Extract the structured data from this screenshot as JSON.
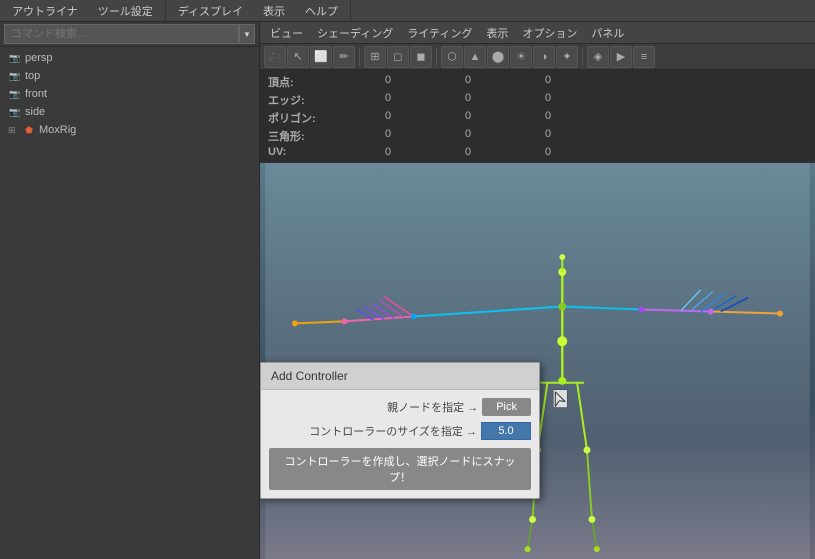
{
  "menuBar": {
    "sections": [
      {
        "name": "outliner",
        "items": [
          "アウトライナ",
          "ツール設定"
        ]
      },
      {
        "name": "display",
        "items": [
          "ディスプレイ",
          "表示",
          "ヘルプ"
        ]
      }
    ]
  },
  "leftPanel": {
    "tabs": [
      "アウトライナ"
    ],
    "toolbar": [
      "ディスプレイ",
      "表示",
      "ヘルプ"
    ],
    "searchPlaceholder": "コマンド検索...",
    "treeItems": [
      {
        "id": "persp",
        "label": "persp",
        "indent": 4,
        "icon": "camera"
      },
      {
        "id": "top",
        "label": "top",
        "indent": 4,
        "icon": "camera"
      },
      {
        "id": "front",
        "label": "front",
        "indent": 4,
        "icon": "camera"
      },
      {
        "id": "side",
        "label": "side",
        "indent": 4,
        "icon": "camera"
      },
      {
        "id": "moxrig",
        "label": "MoxRig",
        "indent": 0,
        "icon": "group",
        "expand": true
      }
    ]
  },
  "viewport": {
    "menus": [
      "ビュー",
      "シェーディング",
      "ライティング",
      "表示",
      "オプション",
      "パネル"
    ],
    "stats": {
      "labels": [
        "頂点:",
        "エッジ:",
        "ポリゴン:",
        "三角形:",
        "UV:"
      ],
      "cols": [
        "0",
        "0",
        "0",
        "0",
        "0",
        "0",
        "0",
        "0",
        "0",
        "0",
        "0",
        "0"
      ]
    }
  },
  "dialog": {
    "title": "Add Controller",
    "rows": [
      {
        "label": "親ノードを指定 →",
        "type": "button",
        "buttonLabel": "Pick"
      },
      {
        "label": "コントローラーのサイズを指定 →",
        "type": "input",
        "inputValue": "5.0"
      }
    ],
    "createButton": "コントローラーを作成し、選択ノードにスナップ！"
  },
  "stats": {
    "vertex": {
      "label": "頂点:",
      "values": [
        "0",
        "0",
        "0"
      ]
    },
    "edge": {
      "label": "エッジ:",
      "values": [
        "0",
        "0",
        "0"
      ]
    },
    "polygon": {
      "label": "ポリゴン:",
      "values": [
        "0",
        "0",
        "0"
      ]
    },
    "triangle": {
      "label": "三角形:",
      "values": [
        "0",
        "0",
        "0"
      ]
    },
    "uv": {
      "label": "UV:",
      "values": [
        "0",
        "0",
        "0"
      ]
    }
  }
}
